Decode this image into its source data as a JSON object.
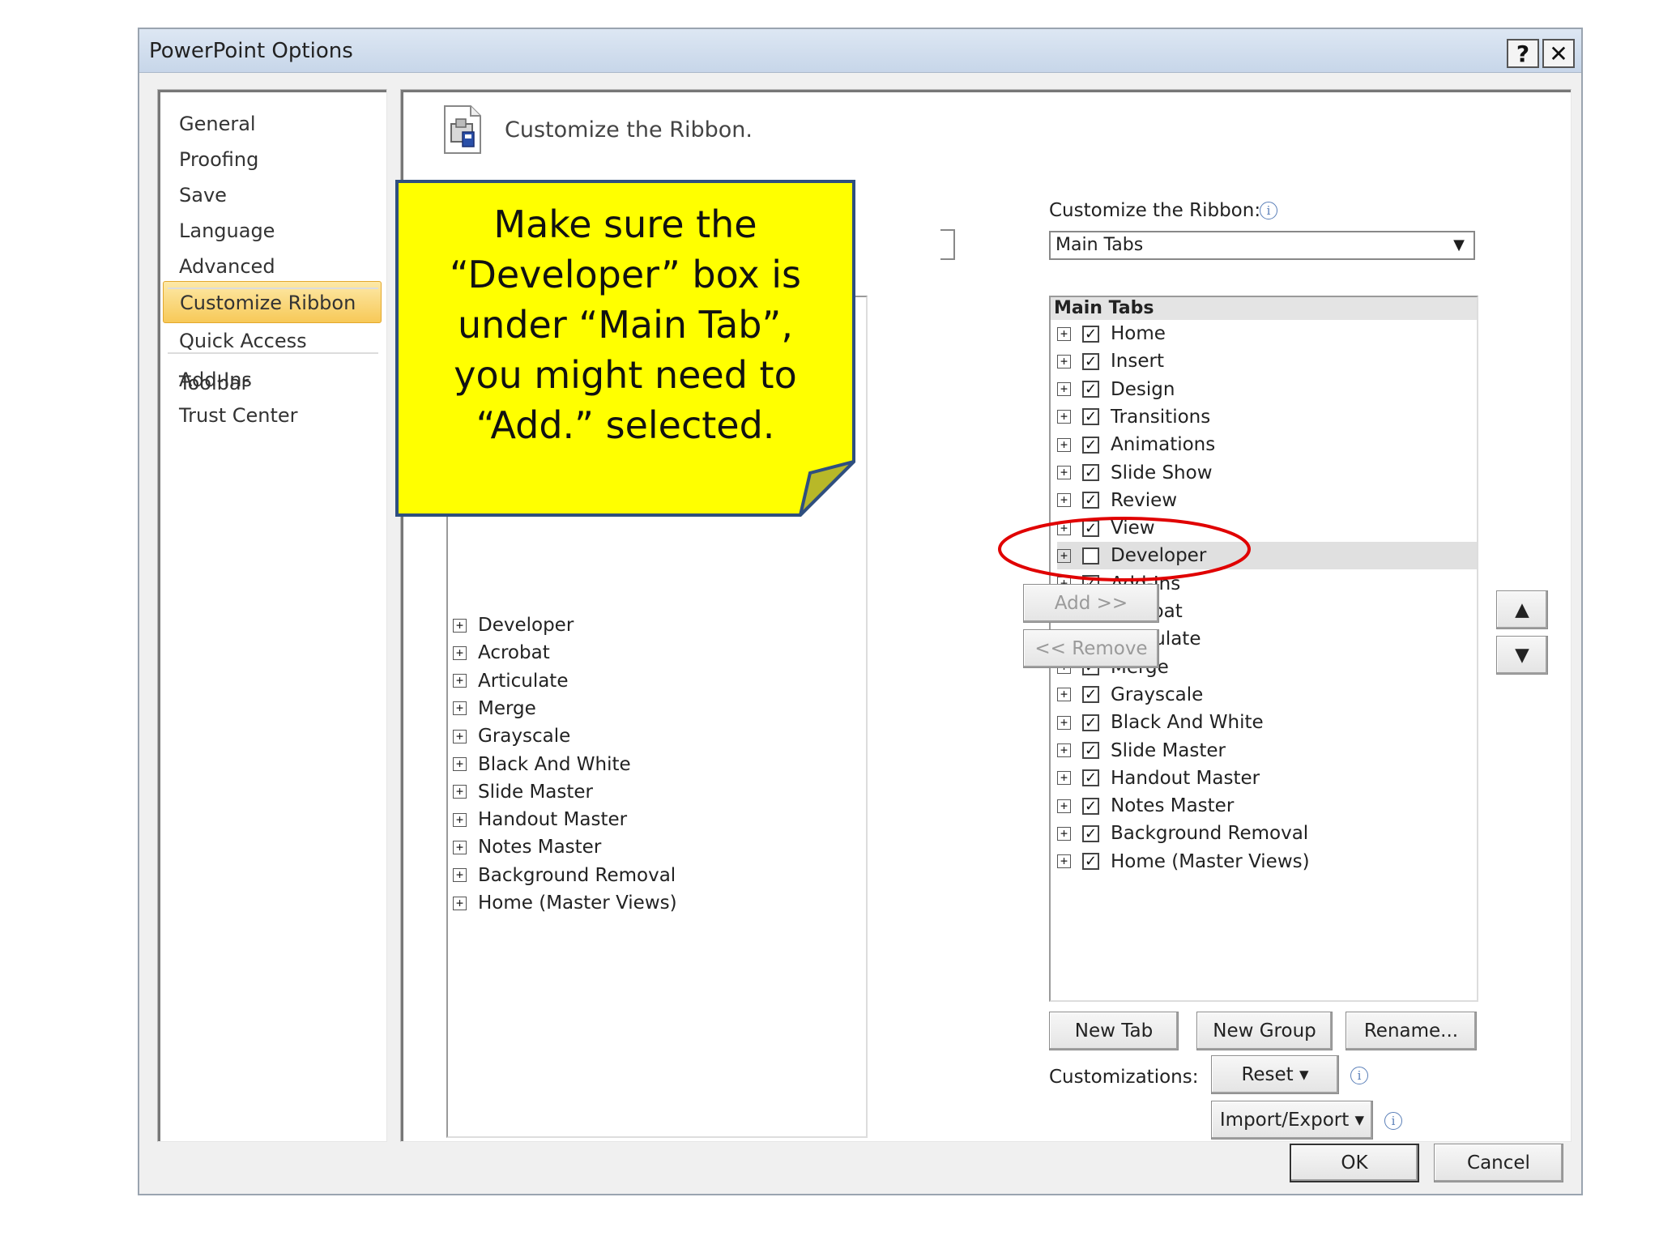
{
  "window": {
    "title": "PowerPoint Options",
    "help_label": "?",
    "close_label": "✕"
  },
  "nav": {
    "items": [
      "General",
      "Proofing",
      "Save",
      "Language",
      "Advanced",
      "Customize Ribbon",
      "Quick Access Toolbar",
      "Add-Ins",
      "Trust Center"
    ],
    "selected": "Customize Ribbon"
  },
  "header": {
    "title": "Customize the Ribbon.",
    "icon": "ribbon-customize-icon"
  },
  "right_panel": {
    "label": "Customize the Ribbon:",
    "dropdown_value": "Main Tabs",
    "list_header": "Main Tabs",
    "items": [
      {
        "label": "Home",
        "checked": true
      },
      {
        "label": "Insert",
        "checked": true
      },
      {
        "label": "Design",
        "checked": true
      },
      {
        "label": "Transitions",
        "checked": true
      },
      {
        "label": "Animations",
        "checked": true
      },
      {
        "label": "Slide Show",
        "checked": true
      },
      {
        "label": "Review",
        "checked": true
      },
      {
        "label": "View",
        "checked": true
      },
      {
        "label": "Developer",
        "checked": false,
        "highlighted": true
      },
      {
        "label": "Add-Ins",
        "checked": true
      },
      {
        "label": "Acrobat",
        "checked": true
      },
      {
        "label": "Articulate",
        "checked": true
      },
      {
        "label": "Merge",
        "checked": true
      },
      {
        "label": "Grayscale",
        "checked": true
      },
      {
        "label": "Black And White",
        "checked": true
      },
      {
        "label": "Slide Master",
        "checked": true
      },
      {
        "label": "Handout Master",
        "checked": true
      },
      {
        "label": "Notes Master",
        "checked": true
      },
      {
        "label": "Background Removal",
        "checked": true
      },
      {
        "label": "Home (Master Views)",
        "checked": true
      }
    ]
  },
  "left_panel": {
    "items": [
      "Developer",
      "Acrobat",
      "Articulate",
      "Merge",
      "Grayscale",
      "Black And White",
      "Slide Master",
      "Handout Master",
      "Notes Master",
      "Background Removal",
      "Home (Master Views)"
    ]
  },
  "buttons": {
    "add": "Add >>",
    "remove": "<< Remove",
    "new_tab": "New Tab",
    "new_group": "New Group",
    "rename": "Rename...",
    "reset": "Reset ▾",
    "import_export": "Import/Export ▾",
    "ok": "OK",
    "cancel": "Cancel",
    "move_up": "▲",
    "move_down": "▼"
  },
  "customizations_label": "Customizations:",
  "callout": {
    "text": "Make sure the “Developer” box is under “Main Tab”, you might need to “Add.” selected.",
    "color": "#ffff00",
    "border_color": "#2f4f7f"
  },
  "annotation": {
    "ellipse_color": "#e00000"
  }
}
